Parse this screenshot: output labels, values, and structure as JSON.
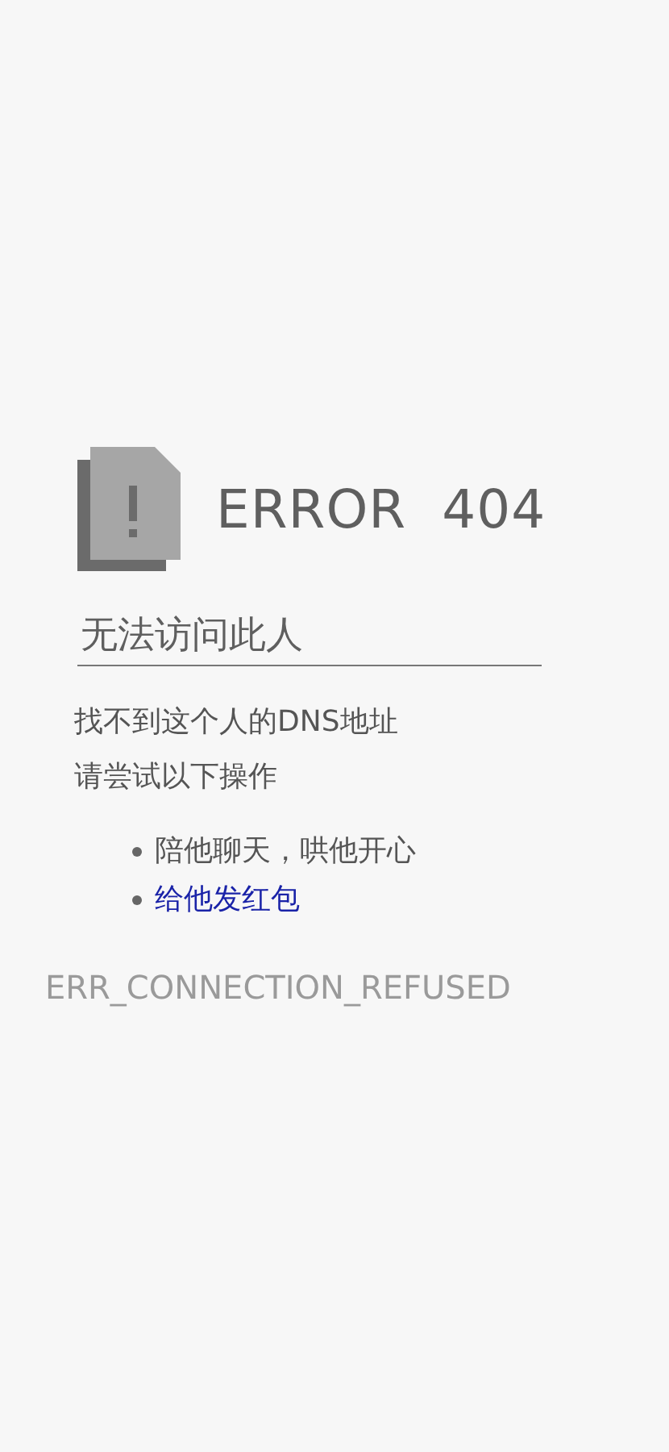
{
  "error_title": "ERROR  404",
  "heading": "无法访问此人",
  "messages": [
    "找不到这个人的DNS地址",
    "请尝试以下操作"
  ],
  "suggestions": [
    {
      "kind": "text",
      "text": "陪他聊天，哄他开心"
    },
    {
      "kind": "link",
      "text": "给他发红包"
    }
  ],
  "error_code": "ERR_CONNECTION_REFUSED"
}
